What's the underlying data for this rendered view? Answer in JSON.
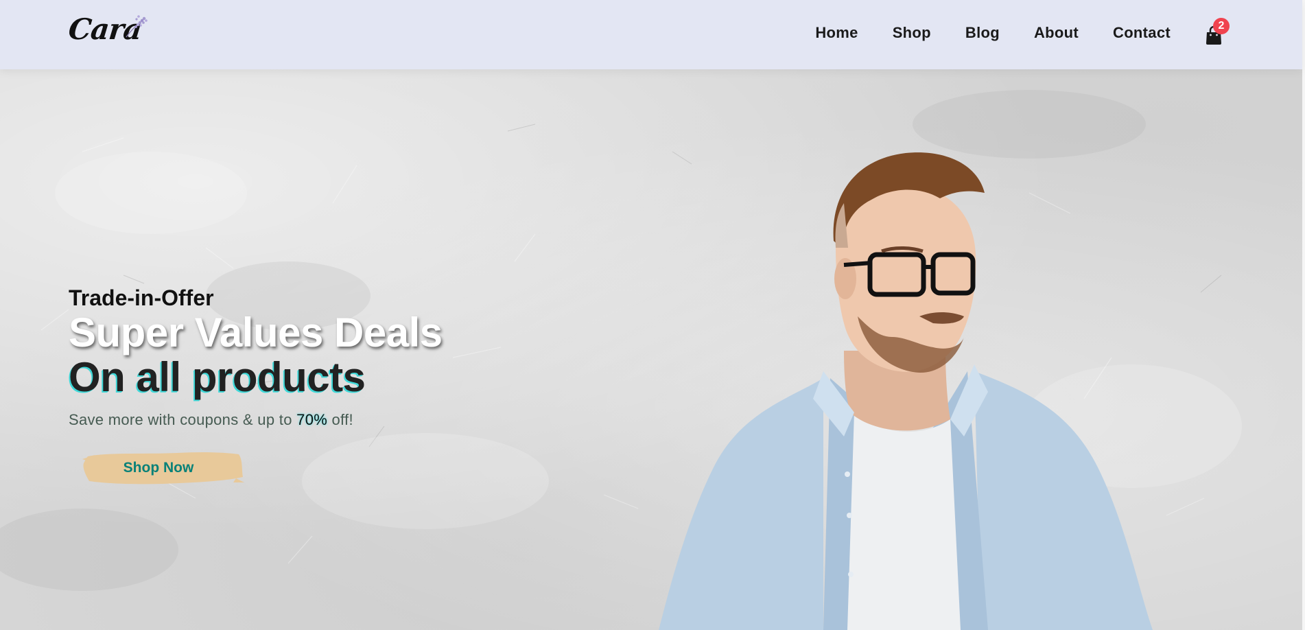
{
  "header": {
    "logo_text": "Cara",
    "nav": [
      {
        "label": "Home"
      },
      {
        "label": "Shop"
      },
      {
        "label": "Blog"
      },
      {
        "label": "About"
      },
      {
        "label": "Contact"
      }
    ],
    "cart_count": "2",
    "cart_icon": "shopping-bag-icon",
    "background": "#e3e6f3"
  },
  "hero": {
    "kicker": "Trade-in-Offer",
    "title": "Super Values Deals",
    "subtitle": "On all products",
    "desc_prefix": "Save more with coupons & up to ",
    "desc_highlight": "70%",
    "desc_suffix": " off!",
    "cta_label": "Shop Now",
    "accent_color": "#088178",
    "badge_color": "#f0434f"
  }
}
